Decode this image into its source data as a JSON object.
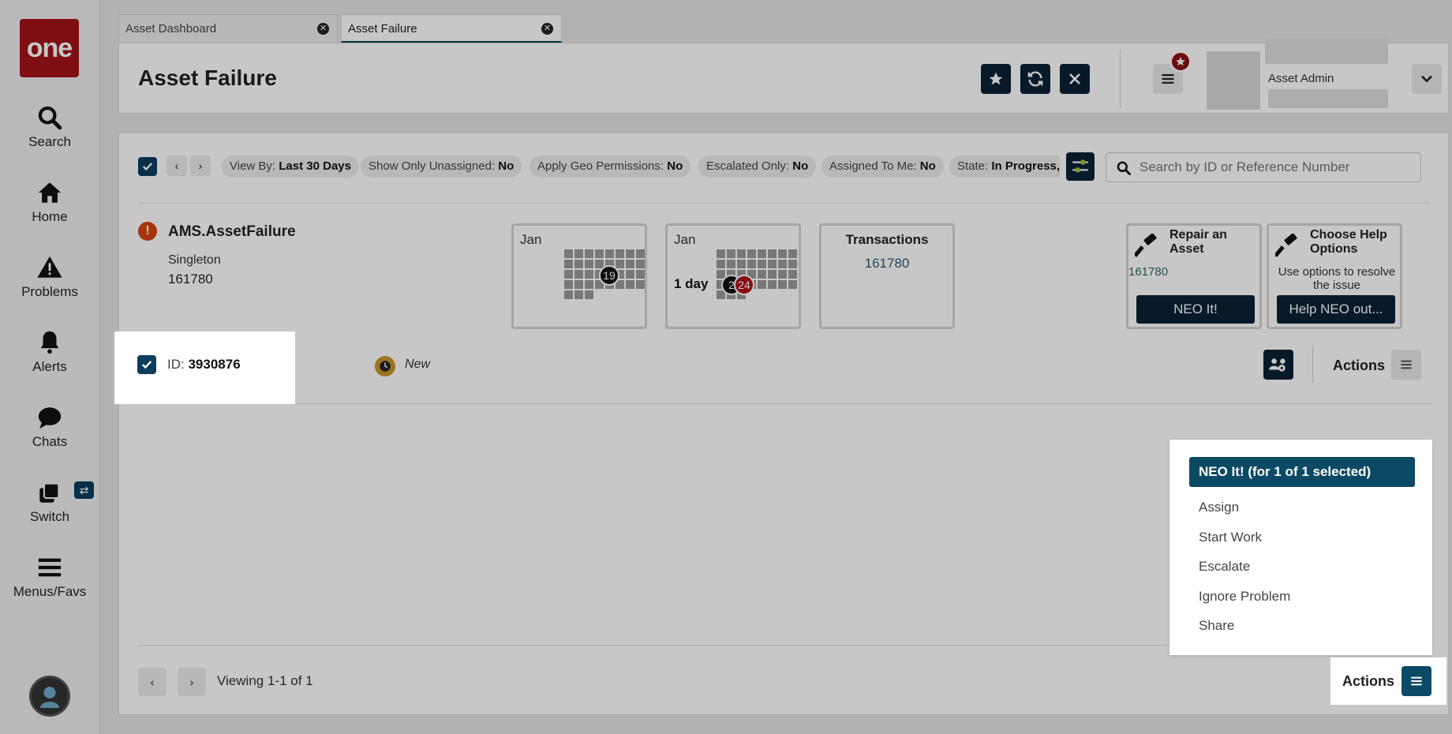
{
  "sidebar": {
    "logo": "one",
    "items": [
      {
        "label": "Search"
      },
      {
        "label": "Home"
      },
      {
        "label": "Problems"
      },
      {
        "label": "Alerts"
      },
      {
        "label": "Chats"
      },
      {
        "label": "Switch"
      },
      {
        "label": "Menus/Favs"
      }
    ]
  },
  "tabs": [
    {
      "label": "Asset Dashboard"
    },
    {
      "label": "Asset Failure",
      "active": true
    }
  ],
  "header": {
    "title": "Asset Failure",
    "profile_name": "Asset Admin"
  },
  "filters": [
    {
      "key": "View By:",
      "value": "Last 30 Days"
    },
    {
      "key": "Show Only Unassigned:",
      "value": "No"
    },
    {
      "key": "Apply Geo Permissions:",
      "value": "No"
    },
    {
      "key": "Escalated Only:",
      "value": "No"
    },
    {
      "key": "Assigned To Me:",
      "value": "No"
    },
    {
      "key": "State:",
      "value": "In Progress,"
    }
  ],
  "search": {
    "placeholder": "Search by ID or Reference Number"
  },
  "problem": {
    "title": "AMS.AssetFailure",
    "subtitle": "Singleton",
    "number": "161780"
  },
  "tiles": {
    "cal1": {
      "month": "Jan",
      "dot": "19"
    },
    "cal2": {
      "month": "Jan",
      "label": "1 day",
      "dot_black": "2",
      "dot_red": "24"
    },
    "transactions": {
      "title": "Transactions",
      "value": "161780"
    },
    "repair": {
      "title": "Repair an Asset",
      "number": "161780",
      "button": "NEO It!"
    },
    "help": {
      "title": "Choose Help Options",
      "desc": "Use options to resolve the issue",
      "button": "Help NEO out..."
    }
  },
  "row": {
    "id_label": "ID:",
    "id_value": "3930876",
    "status": "New",
    "actions_label": "Actions"
  },
  "footer": {
    "viewing": "Viewing 1-1 of 1",
    "actions_label": "Actions"
  },
  "actions_menu": {
    "primary": "NEO It! (for 1 of 1 selected)",
    "items": [
      "Assign",
      "Start Work",
      "Escalate",
      "Ignore Problem",
      "Share"
    ]
  },
  "colors": {
    "brand_red": "#a31419",
    "navy": "#0b2235",
    "teal": "#0b4a64",
    "warning": "#d5450f"
  }
}
